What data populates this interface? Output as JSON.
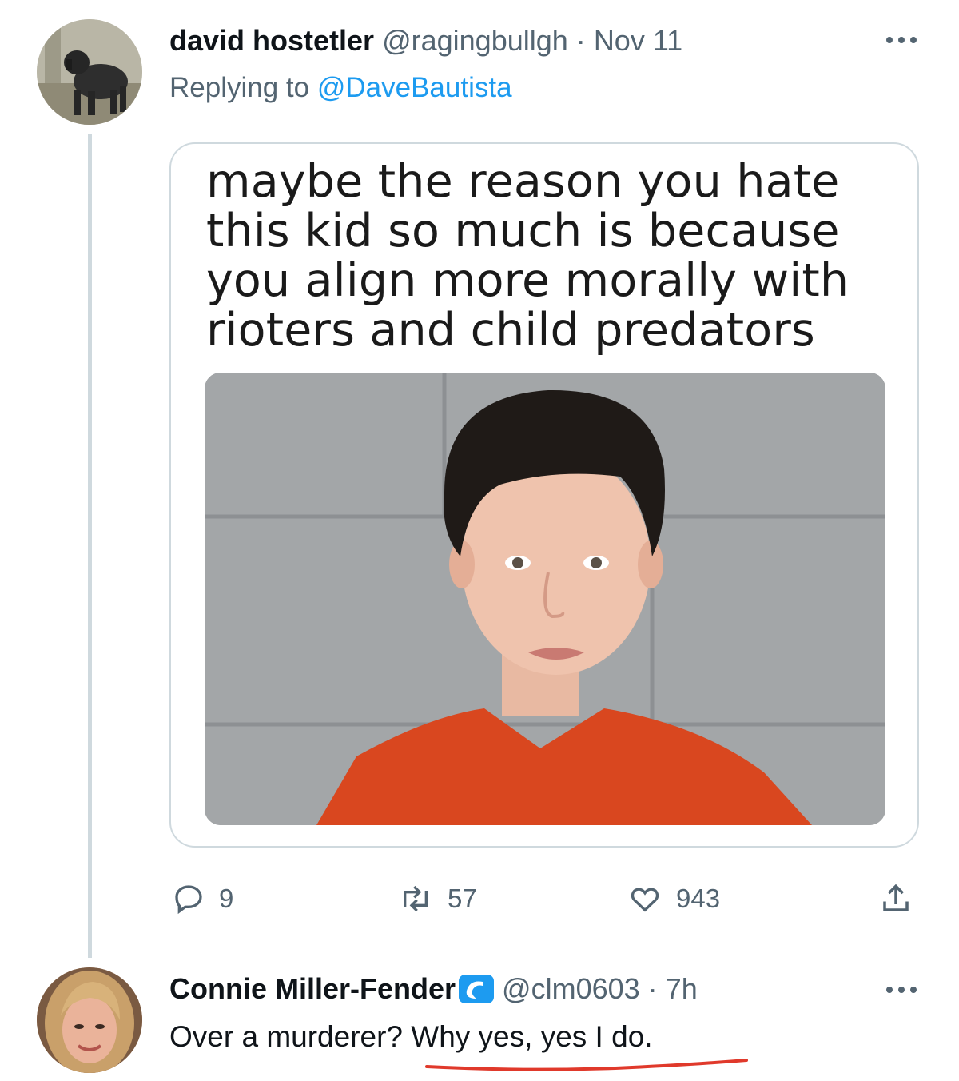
{
  "tweet": {
    "author_name": "david hostetler",
    "author_handle": "@ragingbullgh",
    "separator": "·",
    "date": "Nov 11",
    "replying_prefix": "Replying to",
    "replying_mention": "@DaveBautista",
    "avatar_icon": "dog-avatar",
    "media": {
      "meme_text": "maybe the reason you hate this kid so much is because you align more morally with rioters and child predators",
      "photo_icon": "mugshot-photo"
    },
    "actions": {
      "reply_count": "9",
      "retweet_count": "57",
      "like_count": "943"
    }
  },
  "reply": {
    "author_name": "Connie Miller-Fender",
    "author_handle": "@clm0603",
    "separator": "·",
    "time": "7h",
    "badge_icon": "wave-badge-icon",
    "text_plain": "Over a murderer? ",
    "text_underlined": "Why yes, yes I do.",
    "avatar_icon": "woman-avatar"
  },
  "colors": {
    "text_primary": "#0f1419",
    "text_secondary": "#536471",
    "link": "#1d9bf0",
    "underline_mark": "#e0392b",
    "shirt": "#d9471f"
  }
}
